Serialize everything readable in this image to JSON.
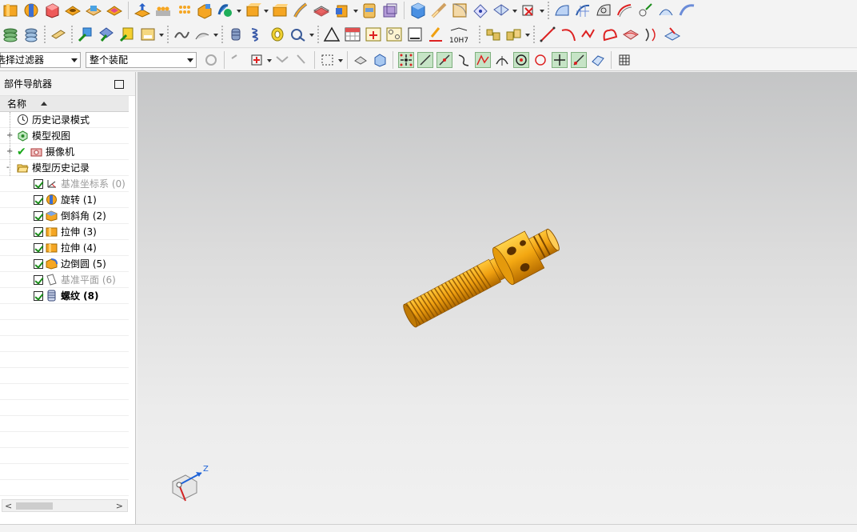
{
  "toolbar_row1": {
    "icons": [
      "extrude-icon",
      "revolve-icon",
      "block-icon",
      "hole-icon",
      "boss-icon",
      "pocket-icon",
      "sweep-icon",
      "pattern-feature-icon",
      "unite-icon",
      "trim-body-icon",
      "split-body-icon",
      "offset-face-icon",
      "draft-icon",
      "chamfer-icon",
      "shell-icon",
      "thicken-icon",
      "emboss-icon",
      "scale-body-icon",
      "extract-geometry-icon",
      "sew-icon",
      "patch-icon",
      "blend-icon",
      "face-blend-icon",
      "studio-surface-icon",
      "through-curves-icon",
      "section-surface-icon",
      "n-sided-icon",
      "swept-surface-icon",
      "offset-surface-icon",
      "ruled-icon",
      "more-surface-icon"
    ]
  },
  "toolbar_row2": {
    "icons": [
      "layer-settings-icon",
      "move-to-layer-icon",
      "annotation-icon",
      "assembly-add-icon",
      "constraints-icon",
      "component-move-icon",
      "text-note-icon",
      "sketch-curve-icon",
      "edge-blend-icon",
      "cylinder-icon",
      "helix-icon",
      "thread-icon",
      "wire-harness-icon",
      "triangle-icon",
      "table-icon",
      "grid-snap-icon",
      "pattern-icon",
      "document-icon",
      "measure-icon",
      "tolerance-icon",
      "parts-list-icon",
      "assembly-parts-icon",
      "line-icon",
      "arc-icon",
      "spline-icon",
      "fillet-curve-icon",
      "surface-curve-icon",
      "offset-curve-icon",
      "project-curve-icon"
    ],
    "tolerance_label": "10H7"
  },
  "selection_bar": {
    "filter_label": "选择过滤器",
    "filter_text": "选择过滤器",
    "scope_value": "整个装配"
  },
  "part_navigator": {
    "title": "部件导航器",
    "column_name": "名称",
    "items": [
      {
        "label": "历史记录模式",
        "icon": "clock-icon",
        "expander": "",
        "checked": false,
        "dim": false,
        "bold": false
      },
      {
        "label": "模型视图",
        "icon": "model-view-icon",
        "expander": "+",
        "checked": false,
        "dim": false,
        "bold": false
      },
      {
        "label": "摄像机",
        "icon": "camera-icon",
        "expander": "+",
        "checked": true,
        "dim": false,
        "bold": false
      },
      {
        "label": "模型历史记录",
        "icon": "folder-open-icon",
        "expander": "-",
        "checked": false,
        "dim": false,
        "bold": false
      }
    ],
    "history": [
      {
        "label": "基准坐标系 (0)",
        "icon": "datum-csys-icon",
        "dim": true,
        "bold": false
      },
      {
        "label": "旋转 (1)",
        "icon": "revolve-icon",
        "dim": false,
        "bold": false
      },
      {
        "label": "倒斜角 (2)",
        "icon": "chamfer-icon",
        "dim": false,
        "bold": false
      },
      {
        "label": "拉伸 (3)",
        "icon": "extrude-icon",
        "dim": false,
        "bold": false
      },
      {
        "label": "拉伸 (4)",
        "icon": "extrude-icon",
        "dim": false,
        "bold": false
      },
      {
        "label": "边倒圆 (5)",
        "icon": "edge-blend-icon",
        "dim": false,
        "bold": false
      },
      {
        "label": "基准平面 (6)",
        "icon": "datum-plane-icon",
        "dim": true,
        "bold": false
      },
      {
        "label": "螺纹 (8)",
        "icon": "thread-icon",
        "dim": false,
        "bold": true
      }
    ]
  },
  "viewport": {
    "triad_axis_label": "Z",
    "model_color": "#f0a010"
  },
  "colors": {
    "accent_orange": "#f0a010",
    "triad_blue": "#1e63d8",
    "triad_red": "#d22222"
  }
}
